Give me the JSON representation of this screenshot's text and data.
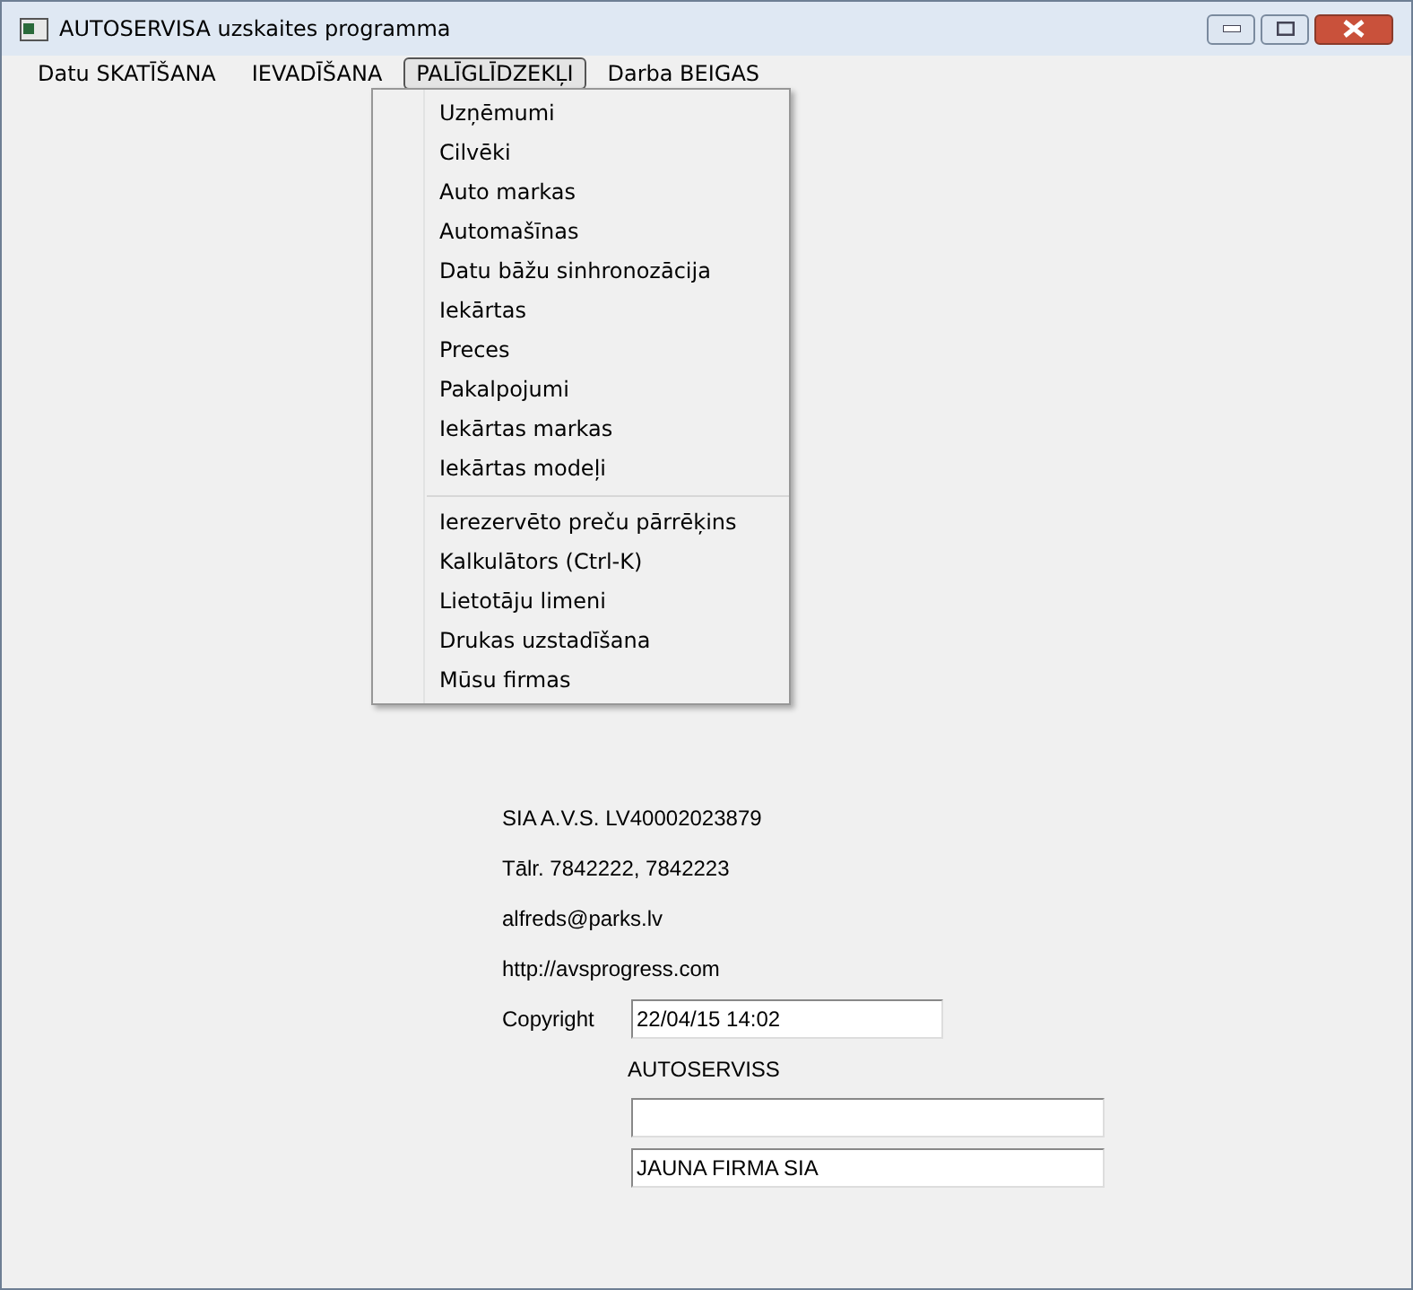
{
  "window": {
    "title": "AUTOSERVISA uzskaites programma"
  },
  "menubar": [
    {
      "label": "Datu SKATĪŠANA",
      "selected": false
    },
    {
      "label": "IEVADĪŠANA",
      "selected": false
    },
    {
      "label": "PALĪGLĪDZEKĻI",
      "selected": true
    },
    {
      "label": "Darba BEIGAS",
      "selected": false
    }
  ],
  "dropdown": {
    "groups": [
      [
        "Uzņēmumi",
        "Cilvēki",
        "Auto markas",
        "Automašīnas",
        "Datu bāžu sinhronozācija",
        "Iekārtas",
        "Preces",
        "Pakalpojumi",
        "Iekārtas markas",
        "Iekārtas modeļi"
      ],
      [
        "Ierezervēto preču pārrēķins",
        "Kalkulātors (Ctrl-K)",
        "Lietotāju limeni",
        "Drukas uzstadīšana",
        "Mūsu firmas"
      ]
    ]
  },
  "info_lines": [
    "SIA A.V.S. LV40002023879",
    "Tālr. 7842222, 7842223",
    "alfreds@parks.lv",
    "http://avsprogress.com"
  ],
  "copyright": {
    "label": "Copyright",
    "value": "22/04/15 14:02"
  },
  "product_name": "AUTOSERVISS",
  "company_fields": [
    {
      "kind": "input"
    },
    {
      "kind": "input",
      "value": "JAUNA FIRMA SIA"
    }
  ]
}
